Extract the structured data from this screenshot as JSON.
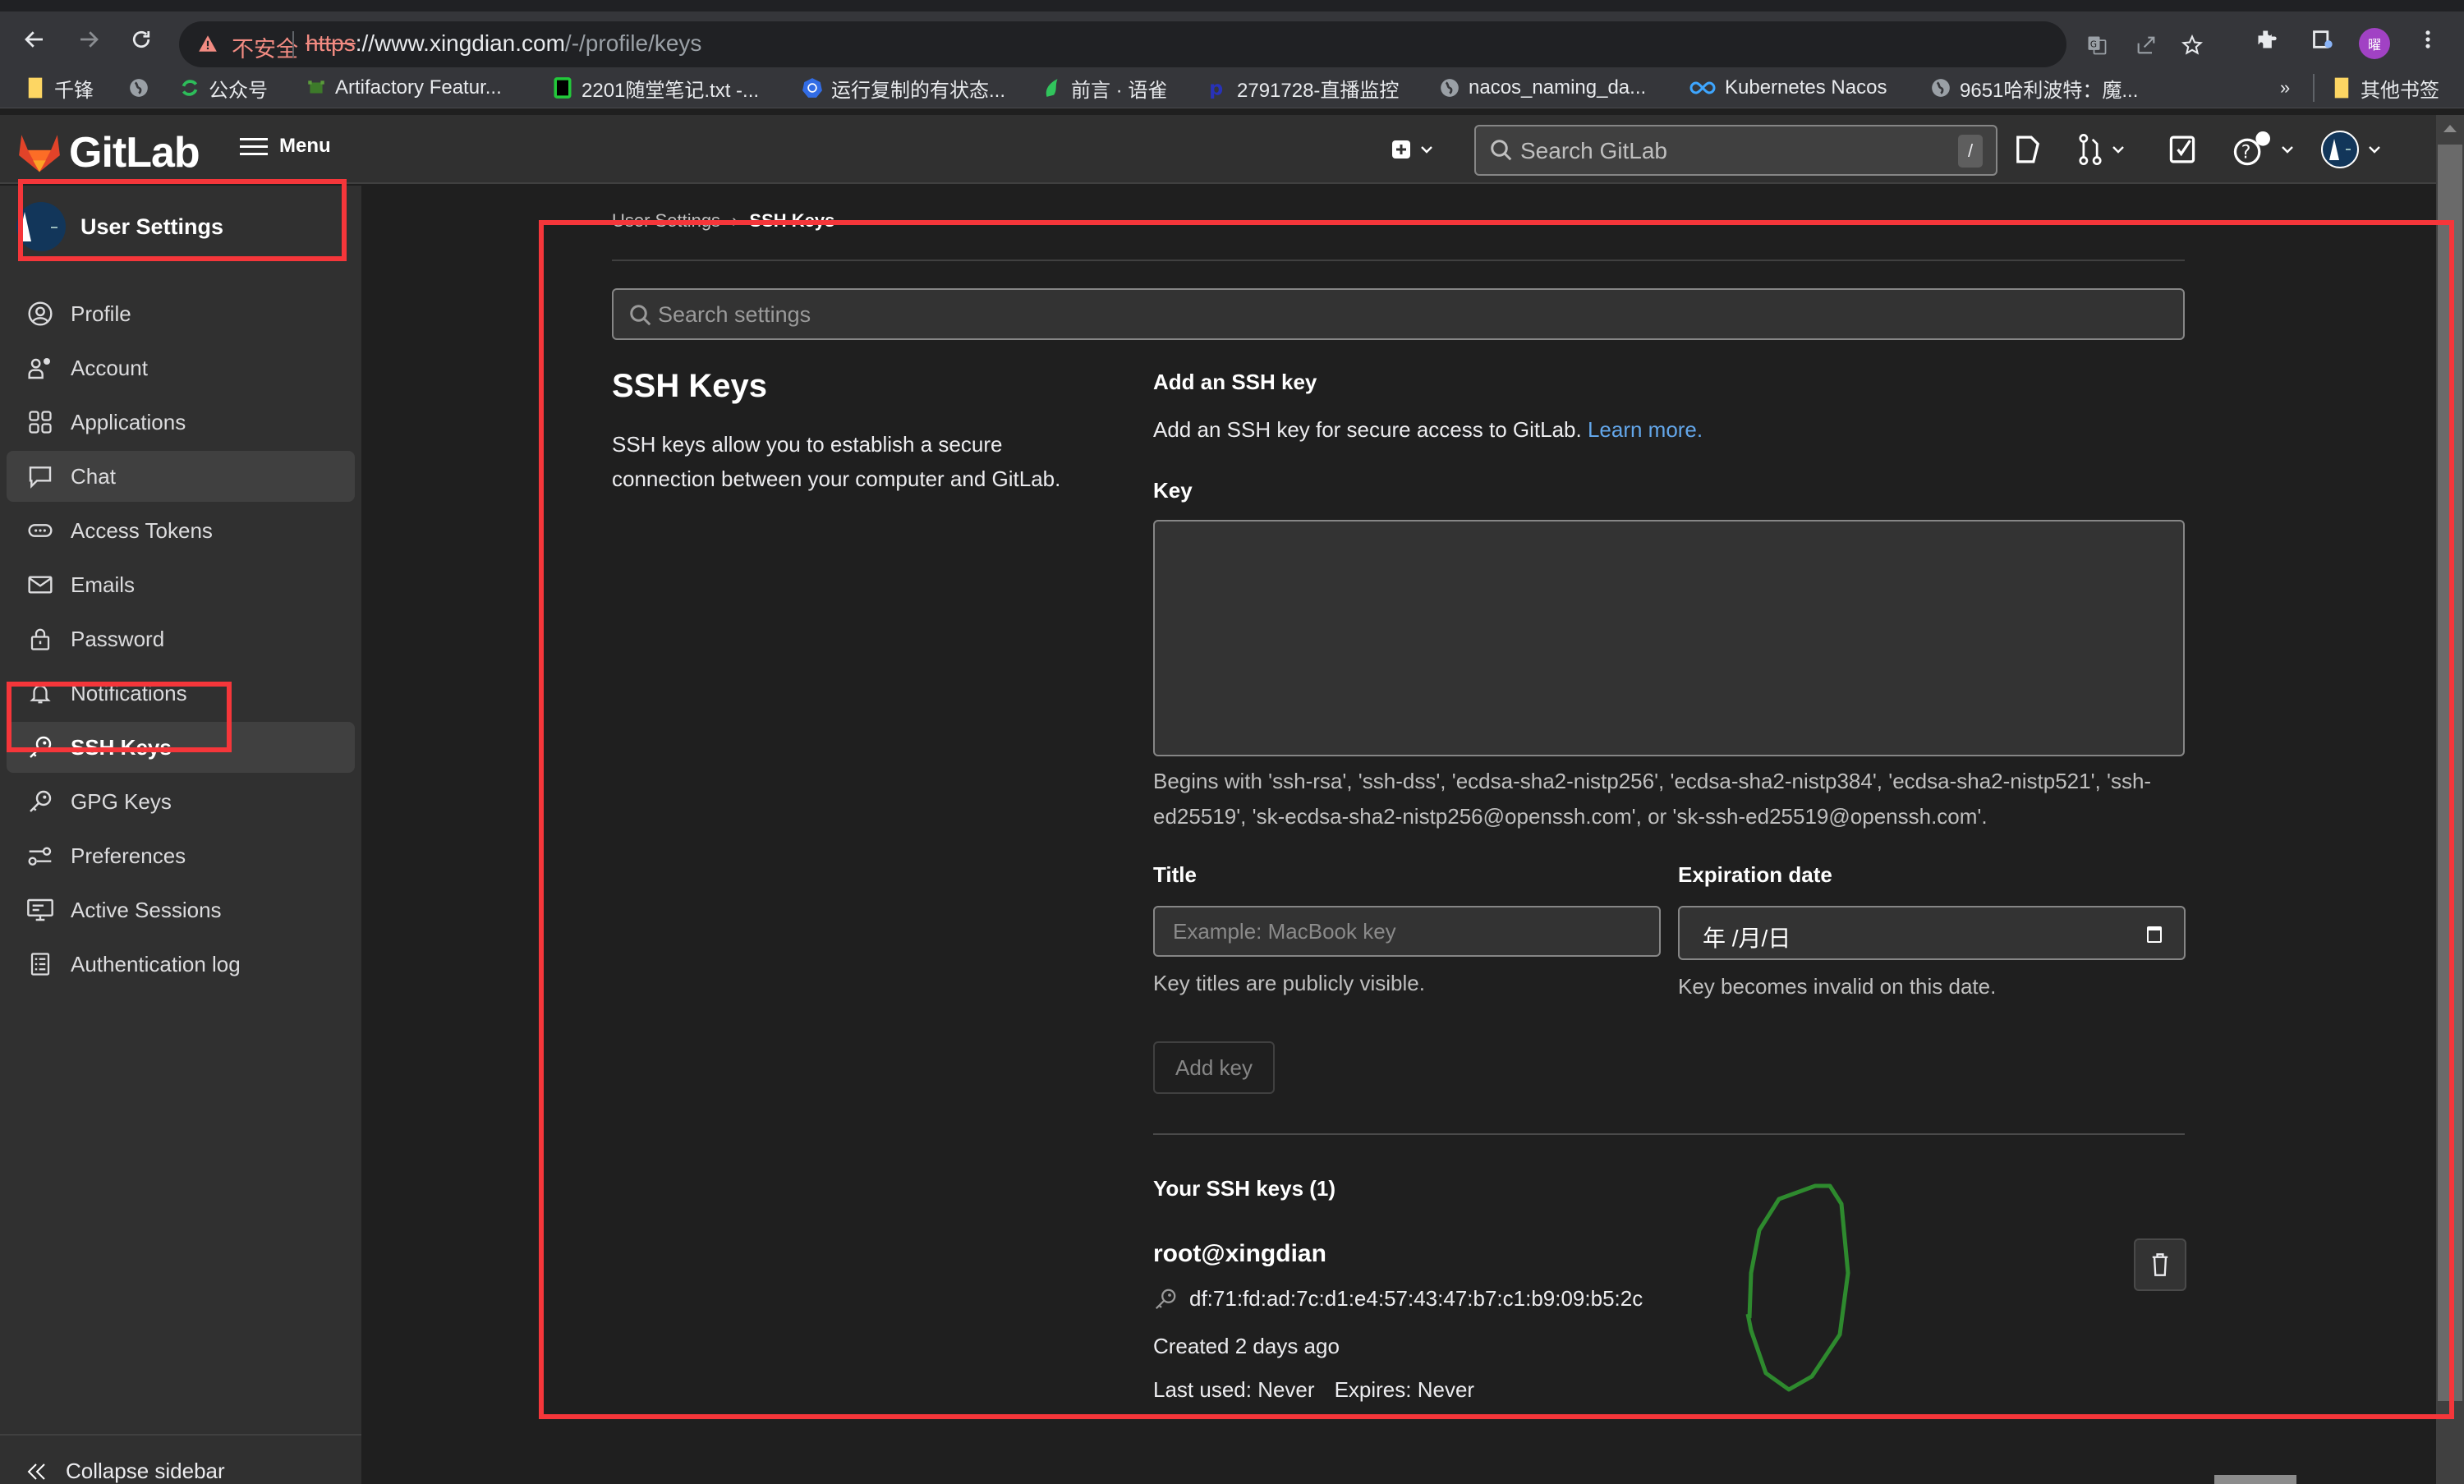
{
  "browser": {
    "security_label": "不安全",
    "url_scheme": "https",
    "url_host": "://www.xingdian.com",
    "url_path": "/-/profile/keys",
    "profile_initial": "曜",
    "bookmarks": [
      {
        "label": "千锋",
        "icon": "folder-icon"
      },
      {
        "label": "",
        "icon": "globe-icon"
      },
      {
        "label": "公众号",
        "icon": "refresh-green-icon"
      },
      {
        "label": "Artifactory Featur...",
        "icon": "frog-icon"
      },
      {
        "label": "2201随堂笔记.txt -...",
        "icon": "note-icon"
      },
      {
        "label": "运行复制的有状态...",
        "icon": "kubernetes-icon"
      },
      {
        "label": "前言 · 语雀",
        "icon": "yuque-icon"
      },
      {
        "label": "2791728-直播监控",
        "icon": "p-icon"
      },
      {
        "label": "nacos_naming_da...",
        "icon": "globe-icon"
      },
      {
        "label": "Kubernetes Nacos",
        "icon": "infinity-icon"
      },
      {
        "label": "9651哈利波特：魔...",
        "icon": "globe-icon"
      }
    ],
    "overflow_label": "»",
    "other_bookmarks": "其他书签"
  },
  "header": {
    "brand": "GitLab",
    "menu_label": "Menu",
    "search_placeholder": "Search GitLab",
    "search_shortcut": "/"
  },
  "sidebar": {
    "context_title": "User Settings",
    "items": [
      {
        "label": "Profile",
        "icon": "profile-icon",
        "state": ""
      },
      {
        "label": "Account",
        "icon": "account-icon",
        "state": ""
      },
      {
        "label": "Applications",
        "icon": "applications-icon",
        "state": ""
      },
      {
        "label": "Chat",
        "icon": "chat-icon",
        "state": "hover"
      },
      {
        "label": "Access Tokens",
        "icon": "token-icon",
        "state": ""
      },
      {
        "label": "Emails",
        "icon": "mail-icon",
        "state": ""
      },
      {
        "label": "Password",
        "icon": "lock-icon",
        "state": ""
      },
      {
        "label": "Notifications",
        "icon": "bell-icon",
        "state": ""
      },
      {
        "label": "SSH Keys",
        "icon": "key-icon",
        "state": "active"
      },
      {
        "label": "GPG Keys",
        "icon": "key-icon",
        "state": ""
      },
      {
        "label": "Preferences",
        "icon": "preferences-icon",
        "state": ""
      },
      {
        "label": "Active Sessions",
        "icon": "monitor-icon",
        "state": ""
      },
      {
        "label": "Authentication log",
        "icon": "log-icon",
        "state": ""
      }
    ],
    "collapse_label": "Collapse sidebar"
  },
  "content": {
    "breadcrumb": {
      "parent": "User Settings",
      "separator": "›",
      "current": "SSH Keys"
    },
    "search_placeholder": "Search settings",
    "section_title": "SSH Keys",
    "section_description": "SSH keys allow you to establish a secure connection between your computer and GitLab.",
    "add_title": "Add an SSH key",
    "add_description": "Add an SSH key for secure access to GitLab.",
    "learn_more": "Learn more.",
    "key_label": "Key",
    "key_value": "",
    "key_help": "Begins with 'ssh-rsa', 'ssh-dss', 'ecdsa-sha2-nistp256', 'ecdsa-sha2-nistp384', 'ecdsa-sha2-nistp521', 'ssh-ed25519', 'sk-ecdsa-sha2-nistp256@openssh.com', or 'sk-ssh-ed25519@openssh.com'.",
    "title_label": "Title",
    "title_placeholder": "Example: MacBook key",
    "title_help": "Key titles are publicly visible.",
    "expiration_label": "Expiration date",
    "expiration_value": "年 /月/日",
    "expiration_help": "Key becomes invalid on this date.",
    "add_button": "Add key",
    "your_keys_title": "Your SSH keys (1)",
    "keys": [
      {
        "name": "root@xingdian",
        "fingerprint": "df:71:fd:ad:7c:d1:e4:57:43:47:b7:c1:b9:09:b5:2c",
        "created": "Created 2 days ago",
        "last_used": "Last used: Never",
        "expires": "Expires: Never"
      }
    ]
  },
  "colors": {
    "annotation_red": "#f5363a",
    "annotation_green": "#2e8a2e",
    "link": "#63a6e9",
    "gitlab_orange": "#e24329"
  }
}
